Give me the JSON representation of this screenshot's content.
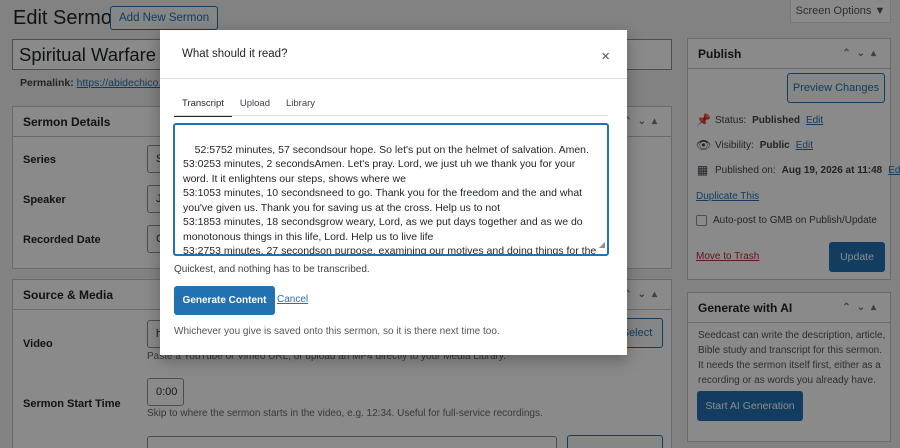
{
  "page": {
    "title": "Edit Sermon",
    "add_new": "Add New Sermon",
    "screen_options": "Screen Options ▼"
  },
  "editor": {
    "title_value": "Spiritual Warfare - H",
    "permalink_label": "Permalink:",
    "permalink_url": "https://abidechico.org"
  },
  "details_box": {
    "title": "Sermon Details",
    "fields": [
      {
        "label": "Series",
        "value": "S"
      },
      {
        "label": "Speaker",
        "value": "J"
      },
      {
        "label": "Recorded Date",
        "value": "C"
      }
    ]
  },
  "media_box": {
    "title": "Source & Media",
    "video_label": "Video",
    "video_value": "h",
    "select_btn": "Select",
    "video_help": "Paste a YouTube or Vimeo URL, or upload an MP4 directly to your Media Library.",
    "start_label": "Sermon Start Time",
    "start_value": "0:00",
    "start_help": "Skip to where the sermon starts in the video, e.g. 12:34. Useful for full-service recordings."
  },
  "publish_box": {
    "title": "Publish",
    "preview_btn": "Preview Changes",
    "status_label": "Status:",
    "status_value": "Published",
    "visibility_label": "Visibility:",
    "visibility_value": "Public",
    "published_label": "Published on:",
    "published_value": "Aug 19, 2026 at 11:48",
    "edit": "Edit",
    "duplicate": "Duplicate This",
    "autopost": "Auto-post to GMB on Publish/Update",
    "trash": "Move to Trash",
    "update_btn": "Update"
  },
  "ai_box": {
    "title": "Generate with AI",
    "description": "Seedcast can write the description, article, Bible study and transcript for this sermon. It needs the sermon itself first, either as a recording or as words you already have.",
    "start_btn": "Start AI Generation"
  },
  "modal": {
    "title": "What should it read?",
    "close": "×",
    "tabs": [
      "Transcript",
      "Upload",
      "Library"
    ],
    "active_tab": "Transcript",
    "transcript": "52:5752 minutes, 57 secondsour hope. So let's put on the helmet of salvation. Amen.\n53:0253 minutes, 2 secondsAmen. Let's pray. Lord, we just uh we thank you for your word. It it enlightens our steps, shows where we\n53:1053 minutes, 10 secondsneed to go. Thank you for the freedom and the and what you've given us. Thank you for saving us at the cross. Help us to not\n53:1853 minutes, 18 secondsgrow weary, Lord, as we put days together and as we do monotonous things in this life, Lord. Help us to live life\n53:2753 minutes, 27 secondson purpose, examining our motives and doing things for the right reason because we love you. Help us, Lord. We need it. Jesus name we pray. Amen.",
    "hint": "Quickest, and nothing has to be transcribed.",
    "generate_btn": "Generate Content",
    "cancel": "Cancel",
    "footer": "Whichever you give is saved onto this sermon, so it is there next time too."
  },
  "colors": {
    "primary": "#2271b1",
    "danger": "#b32d2e"
  }
}
